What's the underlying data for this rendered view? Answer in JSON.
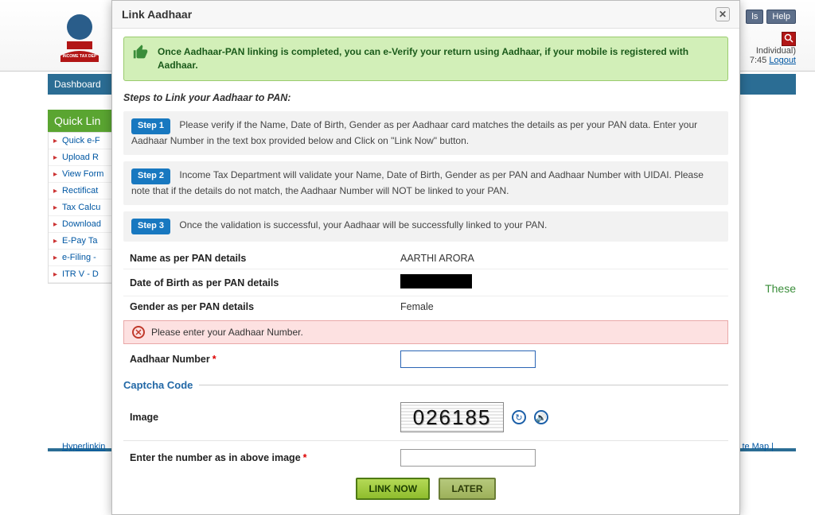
{
  "modal": {
    "title": "Link Aadhaar",
    "banner": "Once Aadhaar-PAN linking is completed, you can e-Verify your return using Aadhaar, if your mobile is registered with Aadhaar.",
    "steps_heading": "Steps to Link your Aadhaar to PAN:",
    "step1_label": "Step 1",
    "step1_text": "Please verify if the Name, Date of Birth, Gender as per Aadhaar card matches the details as per your PAN data. Enter your Aadhaar Number in the text box provided below and Click on \"Link Now\" button.",
    "step2_label": "Step 2",
    "step2_text": "Income Tax Department will validate your Name, Date of Birth, Gender as per PAN and Aadhaar Number with UIDAI. Please note that if the details do not match, the Aadhaar Number will NOT be linked to your PAN.",
    "step3_label": "Step 3",
    "step3_text": "Once the validation is successful, your Aadhaar will be successfully linked to your PAN.",
    "pan": {
      "name_label": "Name as per PAN details",
      "name_value": "AARTHI ARORA",
      "dob_label": "Date of Birth as per PAN details",
      "gender_label": "Gender as per PAN details",
      "gender_value": "Female"
    },
    "error_msg": "Please enter your Aadhaar Number.",
    "aadhaar_label": "Aadhaar Number",
    "captcha": {
      "legend": "Captcha Code",
      "image_label": "Image",
      "image_text": "026185",
      "enter_label": "Enter the number as in above image"
    },
    "buttons": {
      "link": "LINK NOW",
      "later": "LATER"
    }
  },
  "bg": {
    "help_btn1": "ls",
    "help_btn2": "Help",
    "user_type": "Individual)",
    "last_login": "7:45",
    "logout": "Logout",
    "nav_dashboard": "Dashboard",
    "quick_title": "Quick Lin",
    "quick_items": [
      "Quick e-F",
      "Upload R",
      "View Form",
      "Rectificat",
      "Tax Calcu",
      "Download",
      "E-Pay Ta",
      "e-Filing -",
      "ITR V - D"
    ],
    "right_panel": "These",
    "footer_hyper": "Hyperlinkin",
    "footer_map": "te Map  |"
  }
}
